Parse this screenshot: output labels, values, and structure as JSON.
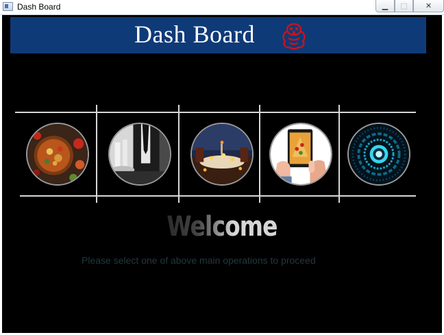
{
  "window": {
    "title": "Dash Board",
    "controls": {
      "minimize": "▁",
      "maximize": "□",
      "close": "✕"
    }
  },
  "banner": {
    "title": "Dash Board"
  },
  "tiles": [
    {
      "name": "food-tile",
      "icon": "food-dish-photo"
    },
    {
      "name": "waiter-tile",
      "icon": "waiter-photo"
    },
    {
      "name": "restaurant-tile",
      "icon": "candlelight-dinner-photo"
    },
    {
      "name": "online-order-tile",
      "icon": "tablet-order-photo"
    },
    {
      "name": "system-tile",
      "icon": "digital-eye-photo"
    }
  ],
  "welcome": {
    "text": "Welcome"
  },
  "instruction": "Please select one of above main operations to proceed",
  "colors": {
    "banner": "#0f3a78",
    "background": "#000000",
    "lines": "#d8d8d8",
    "logo": "#c8141c"
  }
}
